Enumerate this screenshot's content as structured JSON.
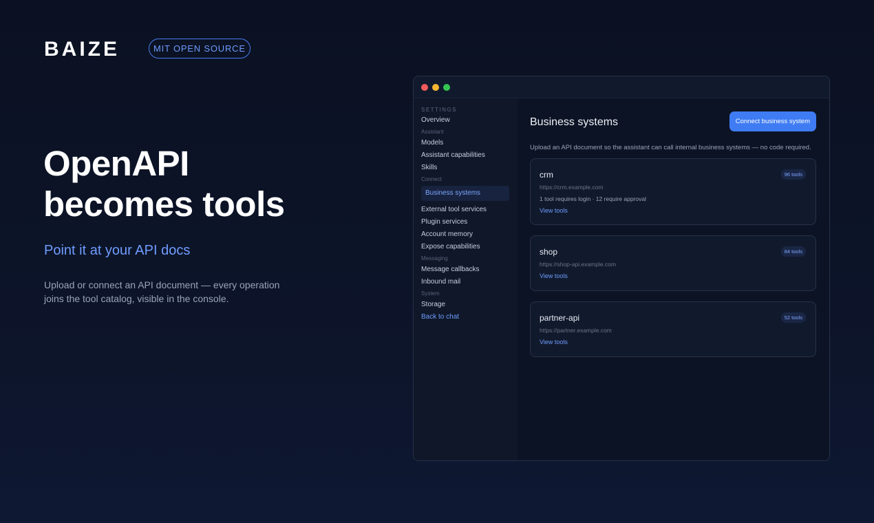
{
  "brand": {
    "logo": "BAIZE",
    "badge": "MIT OPEN SOURCE"
  },
  "hero": {
    "headline_line1": "OpenAPI",
    "headline_line2": "becomes tools",
    "subheadline": "Point it at your API docs",
    "body_line1": "Upload or connect an API document — every operation",
    "body_line2": "joins the tool catalog, visible in the console."
  },
  "window": {
    "traffic_lights": [
      "#f15b5b",
      "#f5b731",
      "#34c553"
    ],
    "sidebar": {
      "section_title": "SETTINGS",
      "overview": "Overview",
      "group_assistant": "Assistant",
      "models": "Models",
      "assistant_capabilities": "Assistant capabilities",
      "skills": "Skills",
      "group_connect": "Connect",
      "business_systems": "Business systems",
      "external_tool_services": "External tool services",
      "plugin_services": "Plugin services",
      "account_memory": "Account memory",
      "expose_capabilities": "Expose capabilities",
      "group_messaging": "Messaging",
      "message_callbacks": "Message callbacks",
      "inbound_mail": "Inbound mail",
      "group_system": "System",
      "storage": "Storage",
      "back_to_chat": "Back to chat"
    },
    "main": {
      "title": "Business systems",
      "connect_button": "Connect business system",
      "description": "Upload an API document so the assistant can call internal business systems — no code required.",
      "systems": [
        {
          "name": "crm",
          "tool_count": "96 tools",
          "url": "https://crm.example.com",
          "note": "1 tool requires login · 12 require approval",
          "link": "View tools"
        },
        {
          "name": "shop",
          "tool_count": "84 tools",
          "url": "https://shop-api.example.com",
          "link": "View tools"
        },
        {
          "name": "partner-api",
          "tool_count": "52 tools",
          "url": "https://partner.example.com",
          "link": "View tools"
        }
      ]
    }
  },
  "colors": {
    "accent": "#3f7cf4",
    "accent_text": "#6f9dff",
    "background": "#0b1122"
  }
}
